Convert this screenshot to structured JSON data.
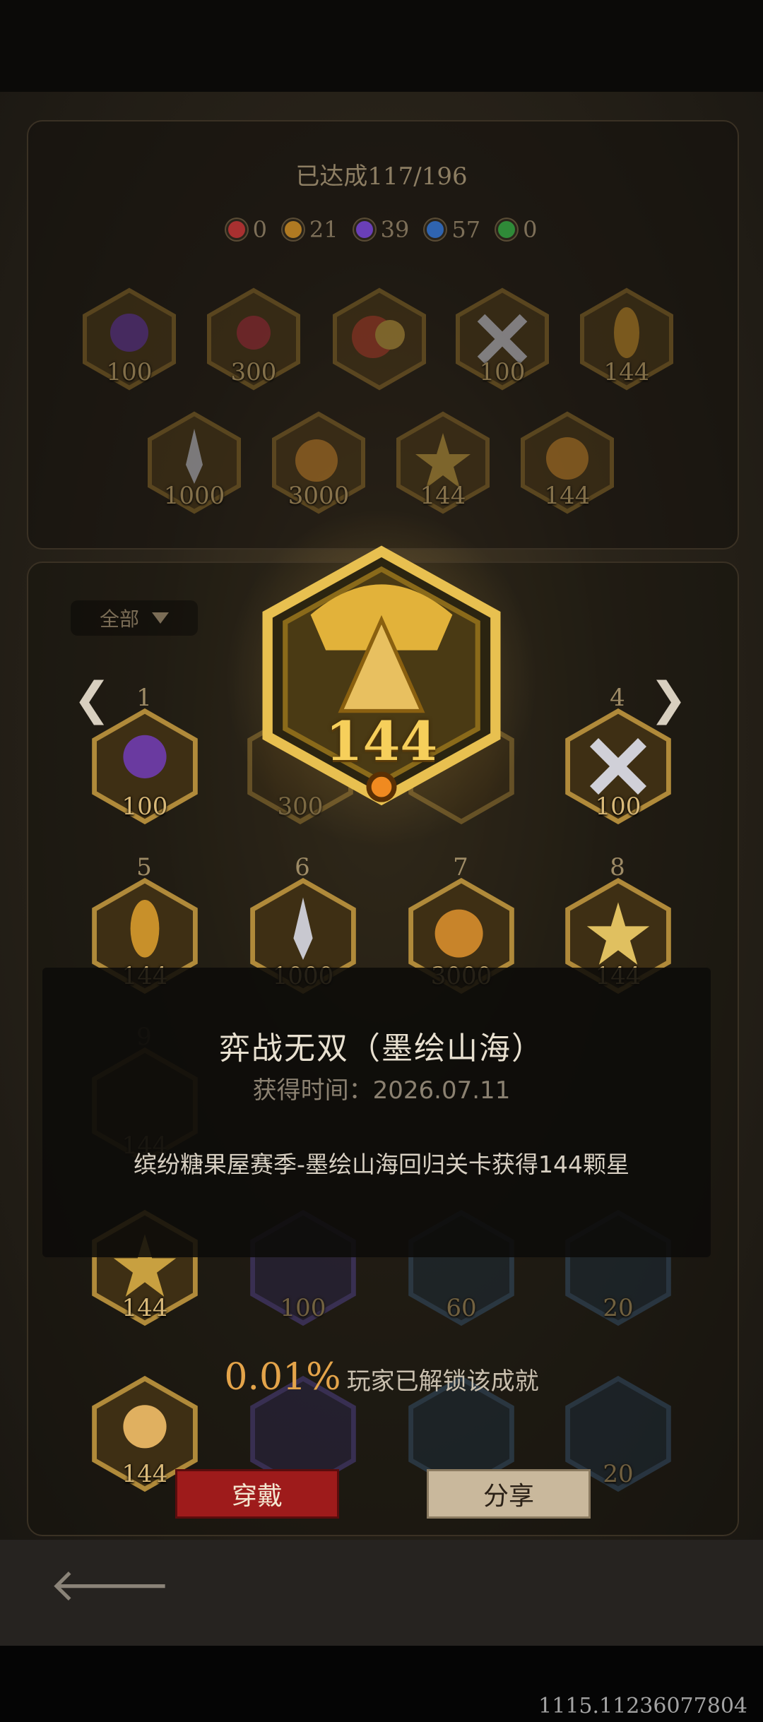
{
  "summary": {
    "count_label": "已达成117/196"
  },
  "gem_counts": [
    {
      "value": "0",
      "color": "#c94040"
    },
    {
      "value": "21",
      "color": "#c48a2a"
    },
    {
      "value": "39",
      "color": "#7a4ad0"
    },
    {
      "value": "57",
      "color": "#3a7ad0"
    },
    {
      "value": "0",
      "color": "#3aa040"
    }
  ],
  "top_badges": [
    "100",
    "300",
    "",
    "100",
    "144",
    "1000",
    "3000",
    "144",
    "144"
  ],
  "filter": {
    "label": "全部"
  },
  "grid": {
    "slot_numbers": [
      "1",
      "4",
      "5",
      "6",
      "7",
      "8",
      "9"
    ],
    "badges": [
      "100",
      "300",
      "",
      "100",
      "144",
      "1000",
      "3000",
      "144",
      "144",
      "144",
      "100",
      "60",
      "20",
      "144",
      "20"
    ]
  },
  "hero": {
    "value": "144"
  },
  "detail": {
    "title": "弈战无双（墨绘山海）",
    "time": "获得时间：2026.07.11",
    "description": "缤纷糖果屋赛季-墨绘山海回归关卡获得144颗星"
  },
  "unlock": {
    "percent": "0.01%",
    "text": "玩家已解锁该成就"
  },
  "buttons": {
    "wear": "穿戴",
    "share": "分享"
  },
  "footer": {
    "id": "1115.11236077804"
  }
}
